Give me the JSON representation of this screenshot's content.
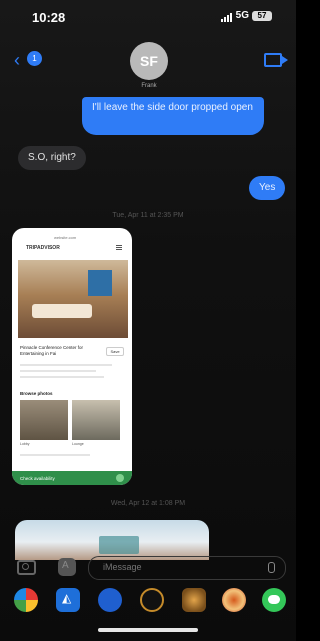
{
  "status_bar": {
    "time": "10:28",
    "network": "5G",
    "battery": "57"
  },
  "header": {
    "back_count": "1",
    "avatar_initials": "SF",
    "contact_name": "Frank"
  },
  "messages": [
    {
      "direction": "outgoing",
      "text": "I'll leave the side door propped open"
    },
    {
      "direction": "incoming",
      "text": "S.O, right?"
    },
    {
      "direction": "outgoing",
      "text": "Yes"
    }
  ],
  "timestamps": {
    "first": "Tue, Apr 11 at 2:35 PM",
    "second": "Wed, Apr 12 at 1:08 PM"
  },
  "attachment": {
    "type": "screenshot",
    "page_url": "website.com",
    "brand": "TRIPADVISOR",
    "title": "Pinnacle Conference Center for Entertaining in Fai",
    "button": "Save",
    "section": "Browse photos",
    "captions": [
      "Lobby",
      "Lounge"
    ],
    "footer": "Check availability"
  },
  "input": {
    "placeholder": "iMessage"
  },
  "app_drawer": [
    "photos-app",
    "app-store",
    "apple-pay",
    "fitness",
    "game",
    "digital-touch",
    "messages-app"
  ]
}
